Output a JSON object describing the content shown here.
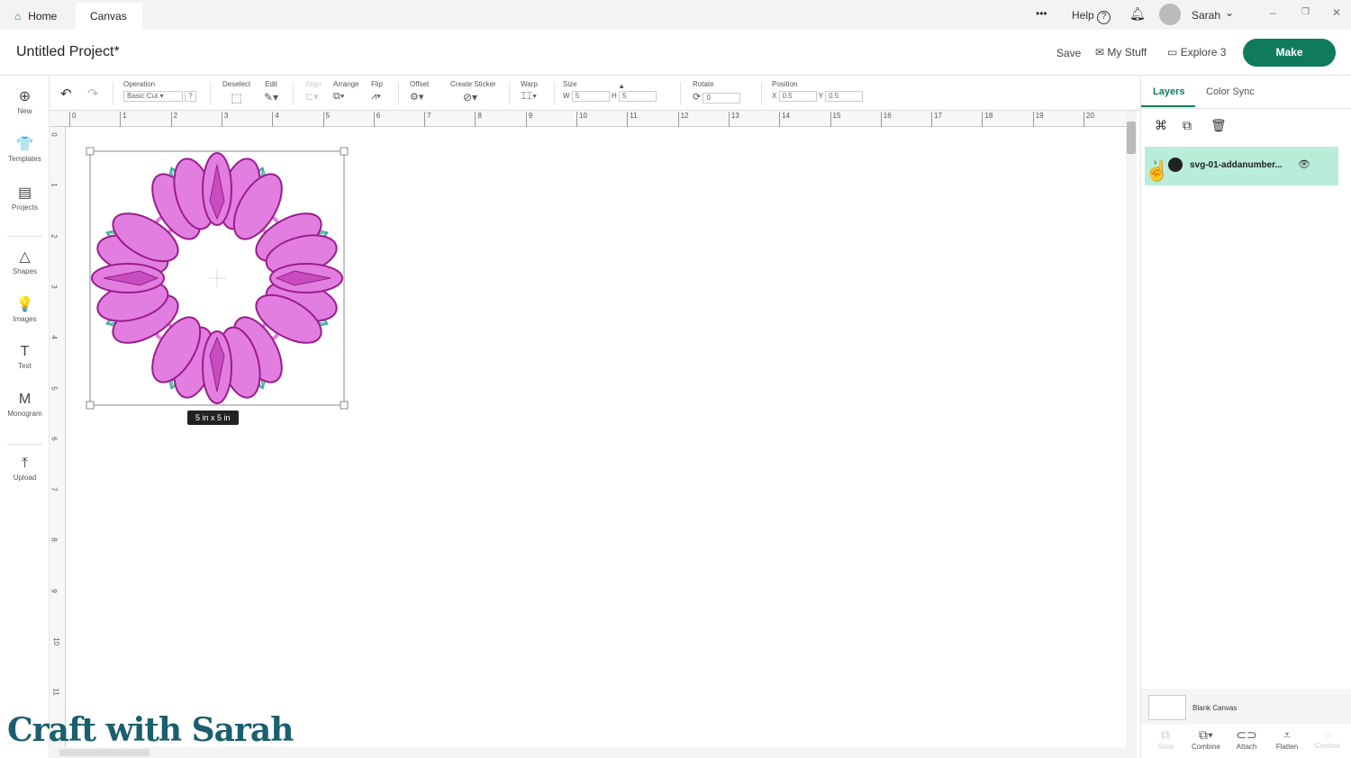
{
  "topbar": {
    "tabs": [
      {
        "label": "Home"
      },
      {
        "label": "Canvas"
      }
    ],
    "more": "•••",
    "help": "Help",
    "user": "Sarah"
  },
  "header": {
    "title": "Untitled Project*",
    "save": "Save",
    "my_stuff": "My Stuff",
    "machine": "Explore 3",
    "make": "Make"
  },
  "toolbar": {
    "operation_label": "Operation",
    "operation_value": "Basic Cut",
    "help": "?",
    "deselect": "Deselect",
    "edit": "Edit",
    "align": "Align",
    "arrange": "Arrange",
    "flip": "Flip",
    "offset": "Offset",
    "create_sticker": "Create Sticker",
    "warp": "Warp",
    "size": "Size",
    "w_label": "W",
    "w": "5",
    "h_label": "H",
    "h": "5",
    "rotate": "Rotate",
    "rotate_value": "0",
    "position": "Position",
    "x_label": "X",
    "x": "0.5",
    "y_label": "Y",
    "y": "0.5"
  },
  "sidebar": [
    {
      "label": "New",
      "icon": "⊕"
    },
    {
      "label": "Templates",
      "icon": "👕"
    },
    {
      "label": "Projects",
      "icon": "▤"
    },
    {
      "label": "Shapes",
      "icon": "△"
    },
    {
      "label": "Images",
      "icon": "💡"
    },
    {
      "label": "Text",
      "icon": "T"
    },
    {
      "label": "Monogram",
      "icon": "M"
    },
    {
      "label": "Upload",
      "icon": "⤒"
    }
  ],
  "rulers": {
    "h": [
      "0",
      "1",
      "2",
      "3",
      "4",
      "5",
      "6",
      "7",
      "8",
      "9",
      "10",
      "11",
      "12",
      "13",
      "14",
      "15",
      "16",
      "17",
      "18",
      "19",
      "20"
    ],
    "v": [
      "0",
      "1",
      "2",
      "3",
      "4",
      "5",
      "6",
      "7",
      "8",
      "9",
      "10",
      "11"
    ]
  },
  "selection": {
    "size_label": "5  in x 5  in"
  },
  "panel": {
    "tabs": [
      "Layers",
      "Color Sync"
    ],
    "layer_name": "svg-01-addanumber...",
    "blank_canvas": "Blank Canvas",
    "bottom": [
      {
        "label": "Slice",
        "enabled": false
      },
      {
        "label": "Combine",
        "enabled": true
      },
      {
        "label": "Attach",
        "enabled": true
      },
      {
        "label": "Flatten",
        "enabled": true
      },
      {
        "label": "Contour",
        "enabled": false
      }
    ]
  },
  "watermark": "Craft with Sarah",
  "colors": {
    "make": "#0f7b5c",
    "pink": "#e27ee0",
    "pink_dark": "#9b1c8e",
    "green": "#6fcfb0",
    "layer_bg": "#b9ecd9"
  }
}
